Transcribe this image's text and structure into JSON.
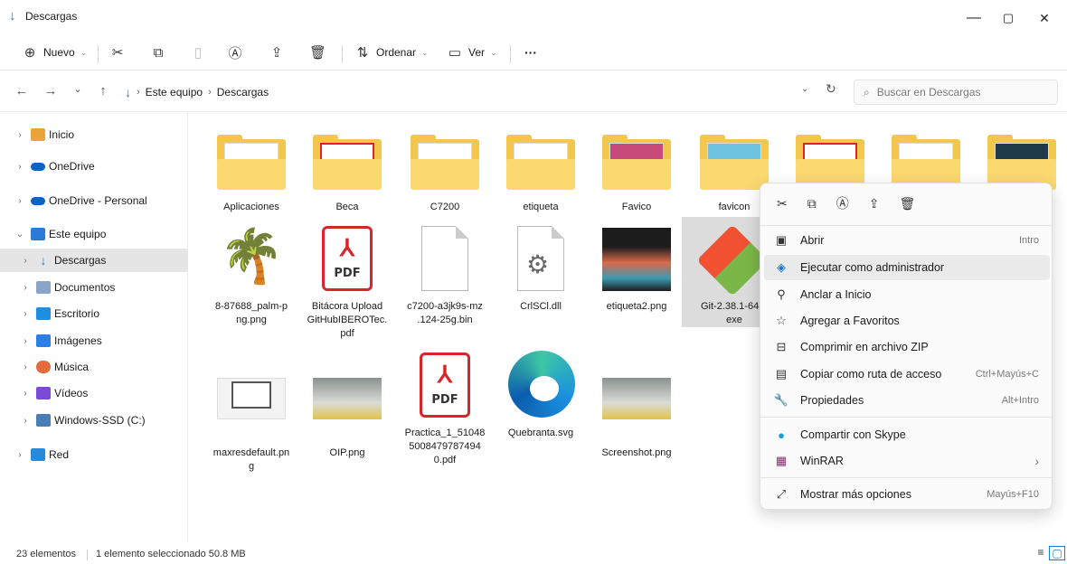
{
  "window": {
    "title": "Descargas",
    "minimize": "—",
    "maximize": "▢",
    "close": "✕"
  },
  "toolbar": {
    "new_label": "Nuevo",
    "sort_label": "Ordenar",
    "view_label": "Ver",
    "more_label": "···"
  },
  "address": {
    "crumbs": [
      "Este equipo",
      "Descargas"
    ],
    "search_placeholder": "Buscar en Descargas"
  },
  "sidebar": {
    "items": [
      {
        "label": "Inicio",
        "color": "#e8a33c"
      },
      {
        "label": "OneDrive",
        "color": "#0a64c8"
      },
      {
        "label": "OneDrive - Personal",
        "color": "#0a64c8"
      },
      {
        "label": "Este equipo",
        "color": "#2b7ad4"
      },
      {
        "label": "Descargas",
        "color": "#1a7ad4"
      },
      {
        "label": "Documentos",
        "color": "#8aa5c8"
      },
      {
        "label": "Escritorio",
        "color": "#1e8fe0"
      },
      {
        "label": "Imágenes",
        "color": "#2a7ee6"
      },
      {
        "label": "Música",
        "color": "#e56b3d"
      },
      {
        "label": "Vídeos",
        "color": "#7b4ad8"
      },
      {
        "label": "Windows-SSD (C:)",
        "color": "#4a7fb6"
      },
      {
        "label": "Red",
        "color": "#2a8ad8"
      }
    ]
  },
  "files": {
    "row1": [
      "Aplicaciones",
      "Beca",
      "C7200",
      "etiqueta",
      "Favico",
      "favicon",
      "",
      "",
      ""
    ],
    "row2": [
      "8-87688_palm-p\nng.png",
      "Bitácora Upload\nGitHubIBEROTec.\npdf",
      "c7200-a3jk9s-mz\n.124-25g.bin",
      "CrlSCl.dll",
      "etiqueta2.png",
      "Git-2.38.1-64-b\nexe"
    ],
    "row3": [
      "maxresdefault.pn\ng",
      "OIP.png",
      "Practica_1_51048\n5008479787494\n0.pdf",
      "Quebranta.svg",
      "Screenshot.png"
    ],
    "pdf_label": "PDF"
  },
  "context_menu": {
    "items": [
      {
        "label": "Abrir",
        "shortcut": "Intro",
        "icon": "open-icon"
      },
      {
        "label": "Ejecutar como administrador",
        "shortcut": "",
        "icon": "shield-icon"
      },
      {
        "label": "Anclar a Inicio",
        "shortcut": "",
        "icon": "pin-icon"
      },
      {
        "label": "Agregar a Favoritos",
        "shortcut": "",
        "icon": "star-icon"
      },
      {
        "label": "Comprimir en archivo ZIP",
        "shortcut": "",
        "icon": "zip-icon"
      },
      {
        "label": "Copiar como ruta de acceso",
        "shortcut": "Ctrl+Mayús+C",
        "icon": "path-icon"
      },
      {
        "label": "Propiedades",
        "shortcut": "Alt+Intro",
        "icon": "wrench-icon"
      },
      {
        "label": "Compartir con Skype",
        "shortcut": "",
        "icon": "skype-icon"
      },
      {
        "label": "WinRAR",
        "shortcut": "›",
        "icon": "winrar-icon"
      },
      {
        "label": "Mostrar más opciones",
        "shortcut": "Mayús+F10",
        "icon": "more-options-icon"
      }
    ]
  },
  "status": {
    "count": "23 elementos",
    "selection": "1 elemento seleccionado  50.8 MB"
  },
  "colors": {
    "accent": "#1a7ad4",
    "folder": "#f2c74b",
    "pdf": "#d9252a"
  }
}
